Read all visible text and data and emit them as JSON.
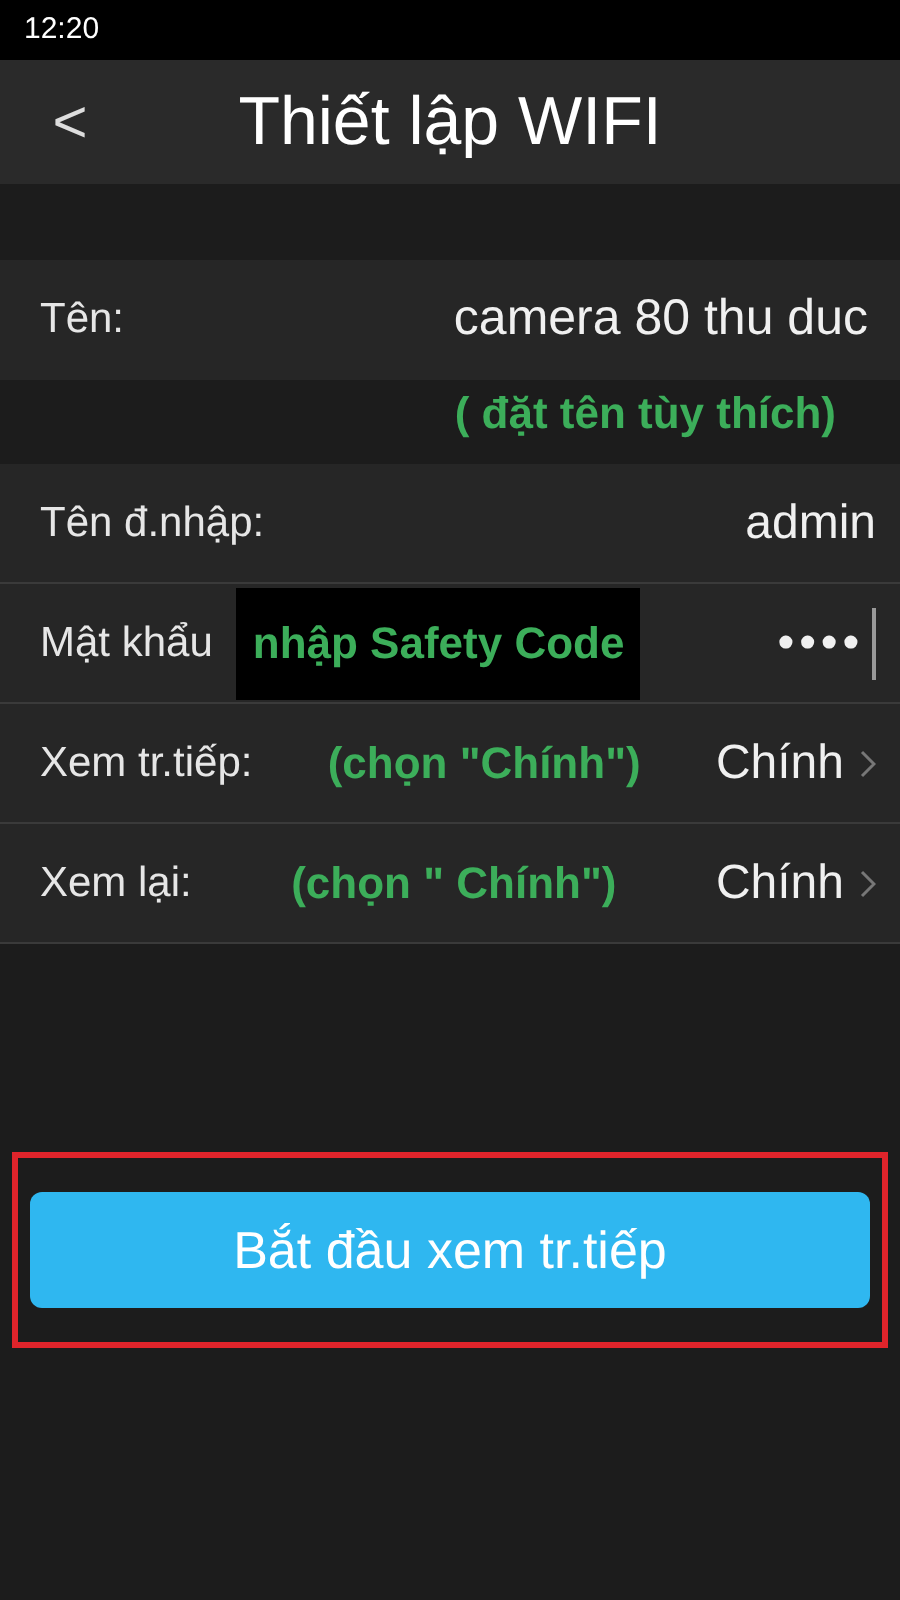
{
  "status_bar": {
    "time": "12:20"
  },
  "header": {
    "back": "<",
    "title": "Thiết lập WIFI"
  },
  "name_row": {
    "label": "Tên:",
    "value": "camera 80 thu duc",
    "note": "( đặt tên tùy thích)"
  },
  "rows": [
    {
      "kind": "text",
      "label": "Tên đ.nhập:",
      "value": "admin"
    },
    {
      "kind": "password",
      "label": "Mật khẩu",
      "value": "••••",
      "note": "nhập Safety Code"
    },
    {
      "kind": "select",
      "label": "Xem tr.tiếp:",
      "value": "Chính",
      "note": "(chọn \"Chính\")"
    },
    {
      "kind": "select",
      "label": "Xem lại:",
      "value": "Chính",
      "note": "(chọn \" Chính\")"
    }
  ],
  "start_button": {
    "label": "Bắt đầu xem tr.tiếp",
    "highlighted": true
  }
}
